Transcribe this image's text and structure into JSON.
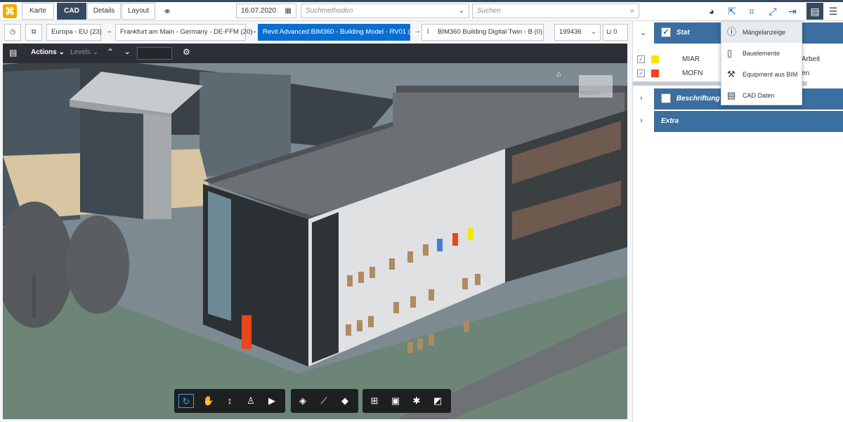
{
  "topbar": {
    "tabs": [
      "Karte",
      "CAD",
      "Details",
      "Layout"
    ],
    "active_tab": "CAD",
    "date": "16.07.2020",
    "method_placeholder": "Suchmethoden",
    "search_placeholder": "Suchen"
  },
  "crumbs": {
    "items": [
      "Europa - EU (23)",
      "Frankfurt am Main - Germany - DE-FFM (20)",
      "Revit Advanced BIM360 - Building Model - RV01 (4)",
      "BIM360 Building Digital Twin - B (0)"
    ],
    "selected": "Revit Advanced BIM360 - Building Model - RV01 (4)",
    "id_value": "199436",
    "cart_count": "0"
  },
  "viewer": {
    "actions_label": "Actions",
    "levels_label": "Levels",
    "level_input": "",
    "nav_cube_label": "RECHTS"
  },
  "panel": {
    "stat_label": "Stat",
    "legend": [
      {
        "code": "MIAR",
        "suffix": "Arbeit",
        "color": "#f5e600"
      },
      {
        "code": "MOFN",
        "suffix": "en",
        "color": "#e8461c"
      }
    ],
    "beschriftung_label": "Beschriftung",
    "extra_label": "Extra"
  },
  "menu": {
    "items": [
      "Mängelanzeige",
      "Bauelemente",
      "Equipment aus BIM",
      "CAD Daten"
    ]
  },
  "colors": {
    "brand": "#354a5f",
    "accent": "#0a6ed1",
    "panel_header": "#3b6ea1"
  }
}
